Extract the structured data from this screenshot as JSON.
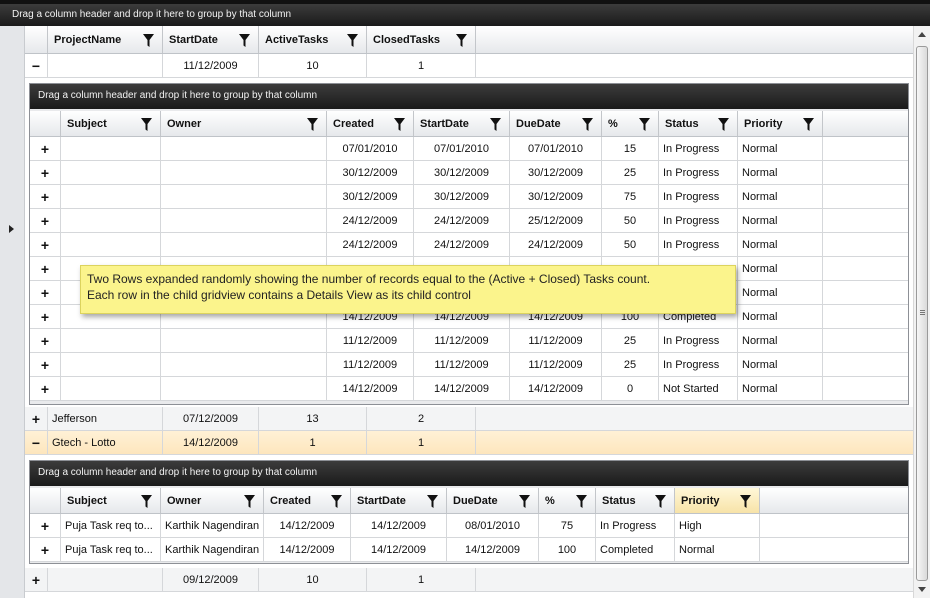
{
  "group_panel_text": "Drag a column header and drop it here to group by that column",
  "master": {
    "columns": [
      "ProjectName",
      "StartDate",
      "ActiveTasks",
      "ClosedTasks"
    ],
    "rows": [
      {
        "toggle": "−",
        "project": "",
        "start": "11/12/2009",
        "active": "10",
        "closed": "1"
      },
      {
        "toggle": "+",
        "project": "Jefferson",
        "start": "07/12/2009",
        "active": "13",
        "closed": "2"
      },
      {
        "toggle": "−",
        "project": "Gtech - Lotto",
        "start": "14/12/2009",
        "active": "1",
        "closed": "1"
      },
      {
        "toggle": "+",
        "project": "",
        "start": "09/12/2009",
        "active": "10",
        "closed": "1"
      }
    ]
  },
  "child1": {
    "group_panel_text": "Drag a column header and drop it here to group by that column",
    "columns": [
      "Subject",
      "Owner",
      "Created",
      "StartDate",
      "DueDate",
      "%",
      "Status",
      "Priority"
    ],
    "rows": [
      {
        "subject": "",
        "owner": "",
        "created": "07/01/2010",
        "start": "07/01/2010",
        "due": "07/01/2010",
        "pct": "15",
        "status": "In Progress",
        "priority": "Normal"
      },
      {
        "subject": "",
        "owner": "",
        "created": "30/12/2009",
        "start": "30/12/2009",
        "due": "30/12/2009",
        "pct": "25",
        "status": "In Progress",
        "priority": "Normal"
      },
      {
        "subject": "",
        "owner": "",
        "created": "30/12/2009",
        "start": "30/12/2009",
        "due": "30/12/2009",
        "pct": "75",
        "status": "In Progress",
        "priority": "Normal"
      },
      {
        "subject": "",
        "owner": "",
        "created": "24/12/2009",
        "start": "24/12/2009",
        "due": "25/12/2009",
        "pct": "50",
        "status": "In Progress",
        "priority": "Normal"
      },
      {
        "subject": "",
        "owner": "",
        "created": "24/12/2009",
        "start": "24/12/2009",
        "due": "24/12/2009",
        "pct": "50",
        "status": "In Progress",
        "priority": "Normal"
      },
      {
        "subject": "",
        "owner": "",
        "created": "",
        "start": "",
        "due": "",
        "pct": "",
        "status": "",
        "priority": "Normal"
      },
      {
        "subject": "",
        "owner": "",
        "created": "",
        "start": "",
        "due": "",
        "pct": "",
        "status": "",
        "priority": "Normal"
      },
      {
        "subject": "",
        "owner": "",
        "created": "14/12/2009",
        "start": "14/12/2009",
        "due": "14/12/2009",
        "pct": "100",
        "status": "Completed",
        "priority": "Normal"
      },
      {
        "subject": "",
        "owner": "",
        "created": "11/12/2009",
        "start": "11/12/2009",
        "due": "11/12/2009",
        "pct": "25",
        "status": "In Progress",
        "priority": "Normal"
      },
      {
        "subject": "",
        "owner": "",
        "created": "11/12/2009",
        "start": "11/12/2009",
        "due": "11/12/2009",
        "pct": "25",
        "status": "In Progress",
        "priority": "Normal"
      },
      {
        "subject": "",
        "owner": "",
        "created": "14/12/2009",
        "start": "14/12/2009",
        "due": "14/12/2009",
        "pct": "0",
        "status": "Not Started",
        "priority": "Normal"
      }
    ]
  },
  "child2": {
    "group_panel_text": "Drag a column header and drop it here to group by that column",
    "columns": [
      "Subject",
      "Owner",
      "Created",
      "StartDate",
      "DueDate",
      "%",
      "Status",
      "Priority"
    ],
    "rows": [
      {
        "subject": "Puja Task req to...",
        "owner": "Karthik Nagendiran",
        "created": "14/12/2009",
        "start": "14/12/2009",
        "due": "08/01/2010",
        "pct": "75",
        "status": "In Progress",
        "priority": "High"
      },
      {
        "subject": "Puja Task req to...",
        "owner": "Karthik Nagendiran",
        "created": "14/12/2009",
        "start": "14/12/2009",
        "due": "14/12/2009",
        "pct": "100",
        "status": "Completed",
        "priority": "Normal"
      }
    ]
  },
  "row_toggle_plus": "+",
  "tooltip": {
    "line1": "Two Rows expanded randomly showing the number of records equal to the (Active + Closed) Tasks count.",
    "line2": "Each row in the child gridview contains a Details View as its child control"
  },
  "colors": {
    "selected_row": "#fde6bd",
    "tooltip_bg": "#fbf48c",
    "group_panel": "#2a2a2a"
  }
}
